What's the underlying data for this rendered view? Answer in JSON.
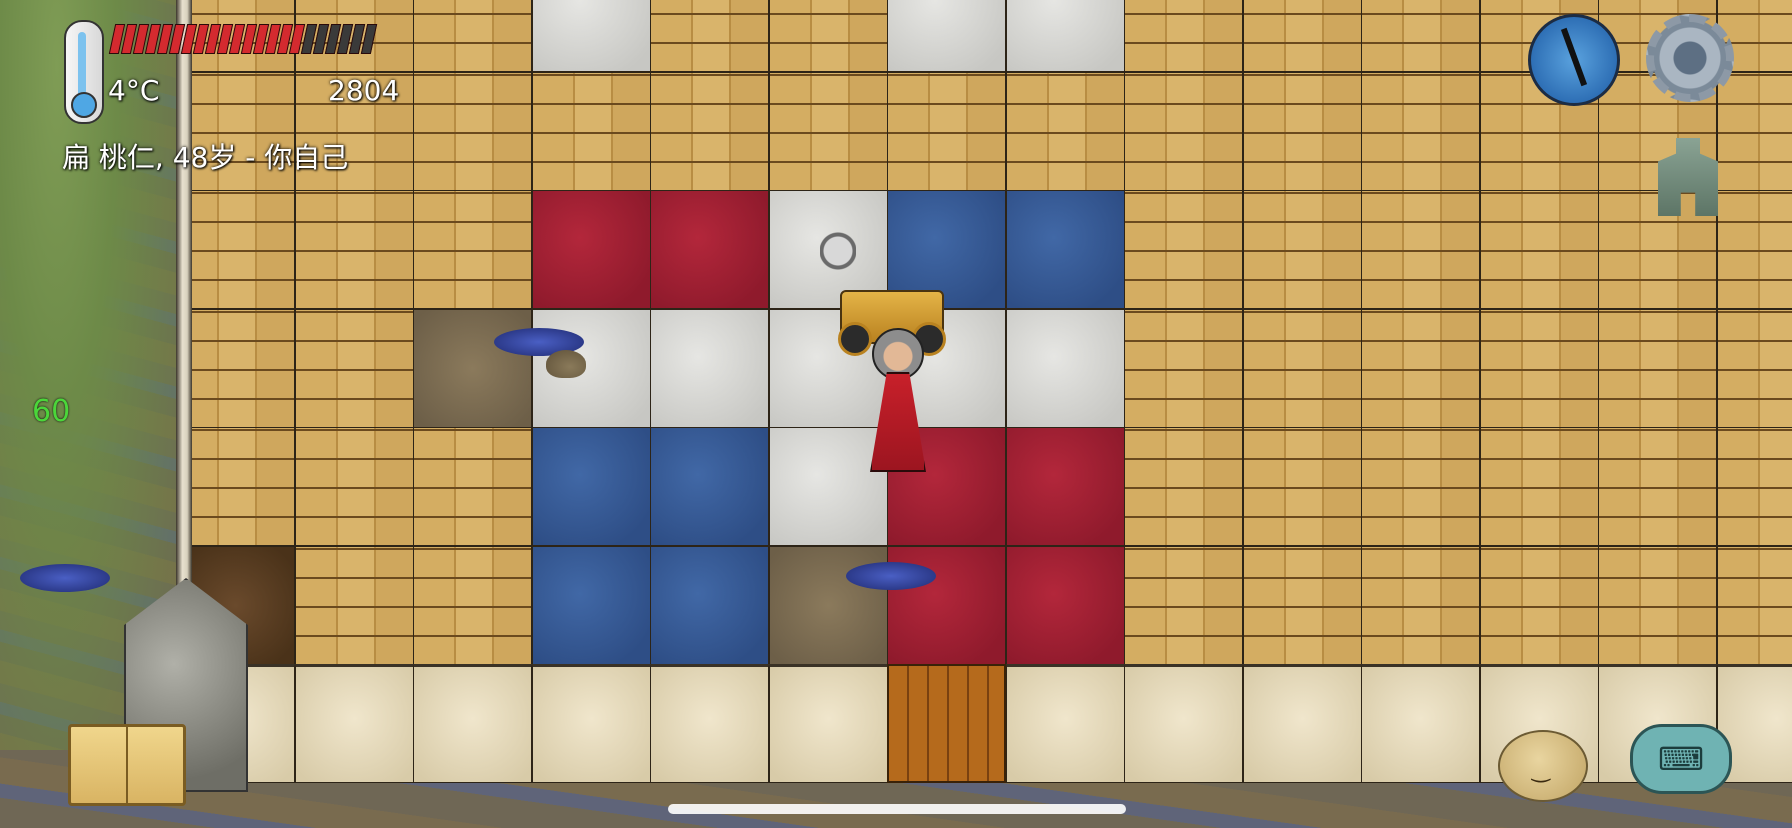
{
  "hud": {
    "temperature": "4°C",
    "score": "2804",
    "player_name_line": "扁 桃仁, 48岁 - 你自己",
    "fps": "60",
    "food_bar": {
      "filled_segments": 16,
      "total_segments": 22
    }
  },
  "colors": {
    "hud_text": "#ffffff",
    "fps_text": "#4bd63a",
    "food_fill": "#d42a2f",
    "food_empty": "#3a3a3a",
    "red_carpet": "#9c1f31",
    "blue_carpet": "#36599a",
    "white_carpet": "#d8d8d5"
  },
  "icons": {
    "thermometer": "thermometer-icon",
    "compass": "compass-icon",
    "settings": "gear-icon",
    "tech_tree": "tech-tree-icon",
    "recipe_book": "book-icon",
    "emote": "emote-face-icon",
    "chat": "keyboard-chat-icon"
  },
  "chat_glyph": "⌨"
}
